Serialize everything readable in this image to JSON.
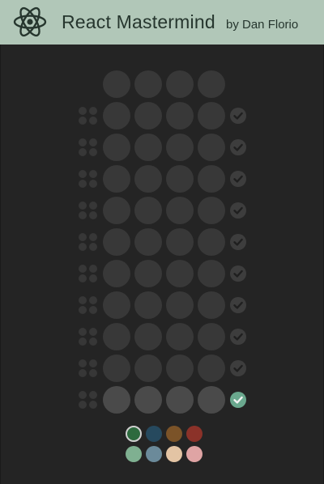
{
  "header": {
    "title": "React Mastermind",
    "byline": "by Dan Florio",
    "logo_icon": "react-atom-icon"
  },
  "board": {
    "rows": 10,
    "holes_per_row": 4,
    "active_row": 10,
    "check_icon": "checkmark-icon"
  },
  "palette": {
    "colors": [
      "#2d6a3e",
      "#26495e",
      "#7b5328",
      "#8b3229",
      "#7fb091",
      "#6b8a9a",
      "#e3c4a4",
      "#dfa4a4"
    ],
    "selected_index": 0
  },
  "theme": {
    "header_bg": "#b1c7b8",
    "board_bg": "#242424",
    "accent": "#6aa88e"
  }
}
